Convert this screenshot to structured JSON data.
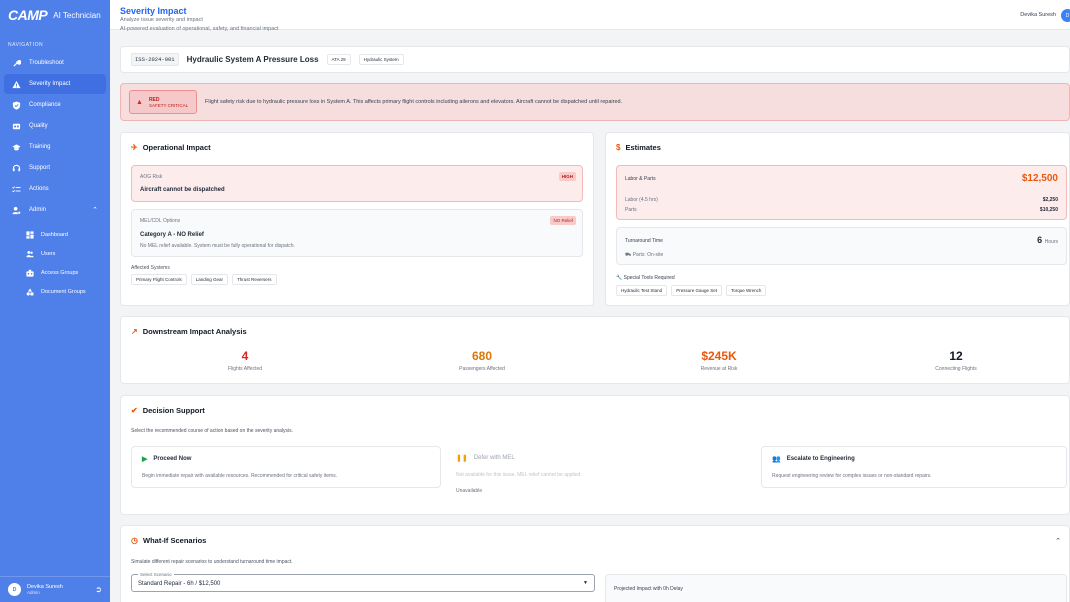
{
  "brand": {
    "logo": "CAMP",
    "app": "AI Technician"
  },
  "sidebar": {
    "nav_label": "NAVIGATION",
    "items": [
      {
        "label": "Troubleshoot"
      },
      {
        "label": "Severity Impact"
      },
      {
        "label": "Compliance"
      },
      {
        "label": "Quality"
      },
      {
        "label": "Training"
      },
      {
        "label": "Support"
      },
      {
        "label": "Actions"
      },
      {
        "label": "Admin"
      }
    ],
    "admin_items": [
      {
        "label": "Dashboard"
      },
      {
        "label": "Users"
      },
      {
        "label": "Access Groups"
      },
      {
        "label": "Document Groups"
      }
    ],
    "user": {
      "initial": "D",
      "name": "Devika Suresh",
      "role": "Admin"
    }
  },
  "header": {
    "title": "Severity Impact",
    "subtitle": "Analyze issue severity and impact",
    "user_name": "Devika Suresh",
    "user_initial": "D"
  },
  "ai_description": "AI-powered evaluation of operational, safety, and financial impact",
  "issue": {
    "id": "ISS-2024-001",
    "title": "Hydraulic System A Pressure Loss",
    "ata": "ATA 29",
    "system": "Hydraulic System"
  },
  "alert": {
    "level": "RED",
    "category": "SAFETY CRITICAL",
    "message": "Flight safety risk due to hydraulic pressure loss in System A. This affects primary flight controls including ailerons and elevators. Aircraft cannot be dispatched until repaired.",
    "color": "#dc2626"
  },
  "operational": {
    "title": "Operational Impact",
    "aog_label": "AOG Risk",
    "aog_badge": "HIGH",
    "aog_value": "Aircraft cannot be dispatched",
    "mel_label": "MEL/CDL Options",
    "mel_badge": "NO Relief",
    "mel_category": "Category A - NO Relief",
    "mel_desc": "No MEL relief available. System must be fully operational for dispatch.",
    "affected_label": "Affected Systems",
    "affected": [
      "Primary Flight Controls",
      "Landing Gear",
      "Thrust Reversers"
    ]
  },
  "estimates": {
    "title": "Estimates",
    "labor_parts_label": "Labor & Parts",
    "total": "$12,500",
    "labor_label": "Labor (4.5 hrs)",
    "labor_value": "$2,250",
    "parts_label": "Parts",
    "parts_value": "$10,250",
    "turnaround_label": "Turnaround Time",
    "turnaround_value": "6",
    "turnaround_unit": "Hours",
    "parts_status": "Parts: On-site",
    "tools_label": "Special Tools Required",
    "tools": [
      "Hydraulic Test Stand",
      "Pressure Gauge Set",
      "Torque Wrench"
    ],
    "accent": "#ea580c"
  },
  "downstream": {
    "title": "Downstream Impact Analysis",
    "metrics": [
      {
        "value": "4",
        "label": "Flights Affected",
        "color": "#dc2626"
      },
      {
        "value": "680",
        "label": "Passengers Affected",
        "color": "#d97706"
      },
      {
        "value": "$245K",
        "label": "Revenue at Risk",
        "color": "#ea580c"
      },
      {
        "value": "12",
        "label": "Connecting Flights",
        "color": "#111827"
      }
    ]
  },
  "decision": {
    "title": "Decision Support",
    "description": "Select the recommended course of action based on the severity analysis.",
    "options": [
      {
        "title": "Proceed Now",
        "desc": "Begin immediate repair with available resources. Recommended for critical safety items."
      },
      {
        "title": "Defer with MEL",
        "desc": "Not available for this issue. MEL relief cannot be applied.",
        "status": "Unavailable"
      },
      {
        "title": "Escalate to Engineering",
        "desc": "Request engineering review for complex issues or non-standard repairs."
      }
    ]
  },
  "whatif": {
    "title": "What-If Scenarios",
    "description": "Simulate different repair scenarios to understand turnaround time impact.",
    "select_label": "Select Scenario",
    "select_value": "Standard Repair - 6h / $12,500",
    "projected_label": "Projected Impact with 0h Delay"
  }
}
